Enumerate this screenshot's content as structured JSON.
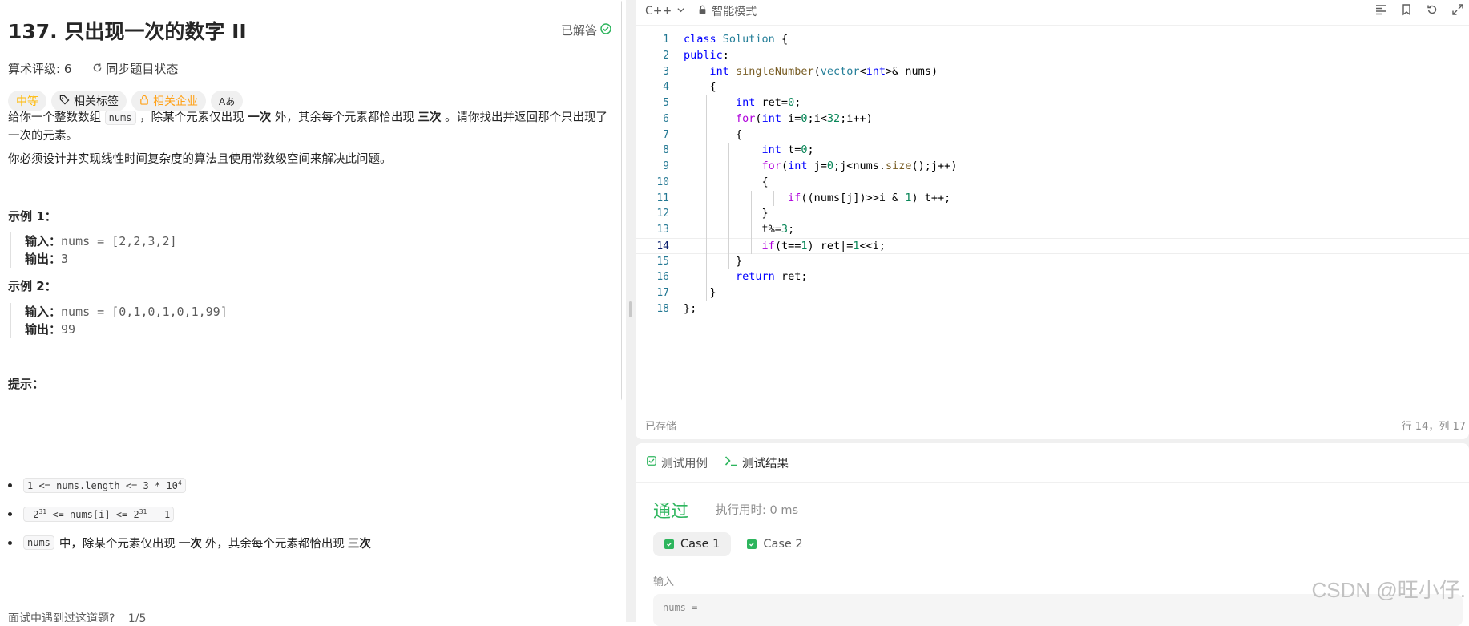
{
  "problem": {
    "title": "137. 只出现一次的数字 II",
    "status": "已解答",
    "rating_label": "算术评级: 6",
    "sync_label": "同步题目状态",
    "tags": {
      "difficulty": "中等",
      "related_tags": "相关标签",
      "related_companies": "相关企业",
      "translate": "Aあ"
    },
    "description": {
      "p1_a": "给你一个整数数组",
      "p1_code": "nums",
      "p1_b": "，除某个元素仅出现",
      "p1_once": "一次",
      "p1_c": "外，其余每个元素都恰出现",
      "p1_three": "三次",
      "p1_d": "。请你找出并返回那个只出现了一次的元素。",
      "p2": "你必须设计并实现线性时间复杂度的算法且使用常数级空间来解决此问题。"
    },
    "examples": [
      {
        "heading": "示例 1：",
        "input_label": "输入：",
        "input": "nums = [2,2,3,2]",
        "output_label": "输出：",
        "output": "3"
      },
      {
        "heading": "示例 2：",
        "input_label": "输入：",
        "input": "nums = [0,1,0,1,0,1,99]",
        "output_label": "输出：",
        "output": "99"
      }
    ],
    "hints_heading": "提示：",
    "hints": {
      "h1_a": "1 <= nums.length <= 3 * 10",
      "h1_sup": "4",
      "h2_a": "-2",
      "h2_sup1": "31",
      "h2_b": " <= nums[i] <= 2",
      "h2_sup2": "31",
      "h2_c": " - 1",
      "h3_code": "nums",
      "h3_a": "中，除某个元素仅出现",
      "h3_once": "一次",
      "h3_b": "外，其余每个元素都恰出现",
      "h3_three": "三次"
    },
    "met_in_interview": "面试中遇到过这道题?",
    "met_count": "1/5"
  },
  "editor": {
    "language": "C++",
    "mode": "智能模式",
    "saved": "已存储",
    "cursor_pos": "行 14，列 17",
    "current_line": 14
  },
  "code_lines": [
    "class Solution {",
    "public:",
    "    int singleNumber(vector<int>& nums)",
    "    {",
    "        int ret=0;",
    "        for(int i=0;i<32;i++)",
    "        {",
    "            int t=0;",
    "            for(int j=0;j<nums.size();j++)",
    "            {",
    "                if((nums[j])>>i & 1) t++;",
    "            }",
    "            t%=3;",
    "            if(t==1) ret|=1<<i;",
    "        }",
    "        return ret;",
    "    }",
    "};"
  ],
  "results": {
    "tab_testcase": "测试用例",
    "tab_result": "测试结果",
    "verdict": "通过",
    "runtime": "执行用时: 0 ms",
    "cases": [
      "Case 1",
      "Case 2"
    ],
    "input_label": "输入",
    "input_value": "nums ="
  },
  "watermark": "CSDN @旺小仔."
}
